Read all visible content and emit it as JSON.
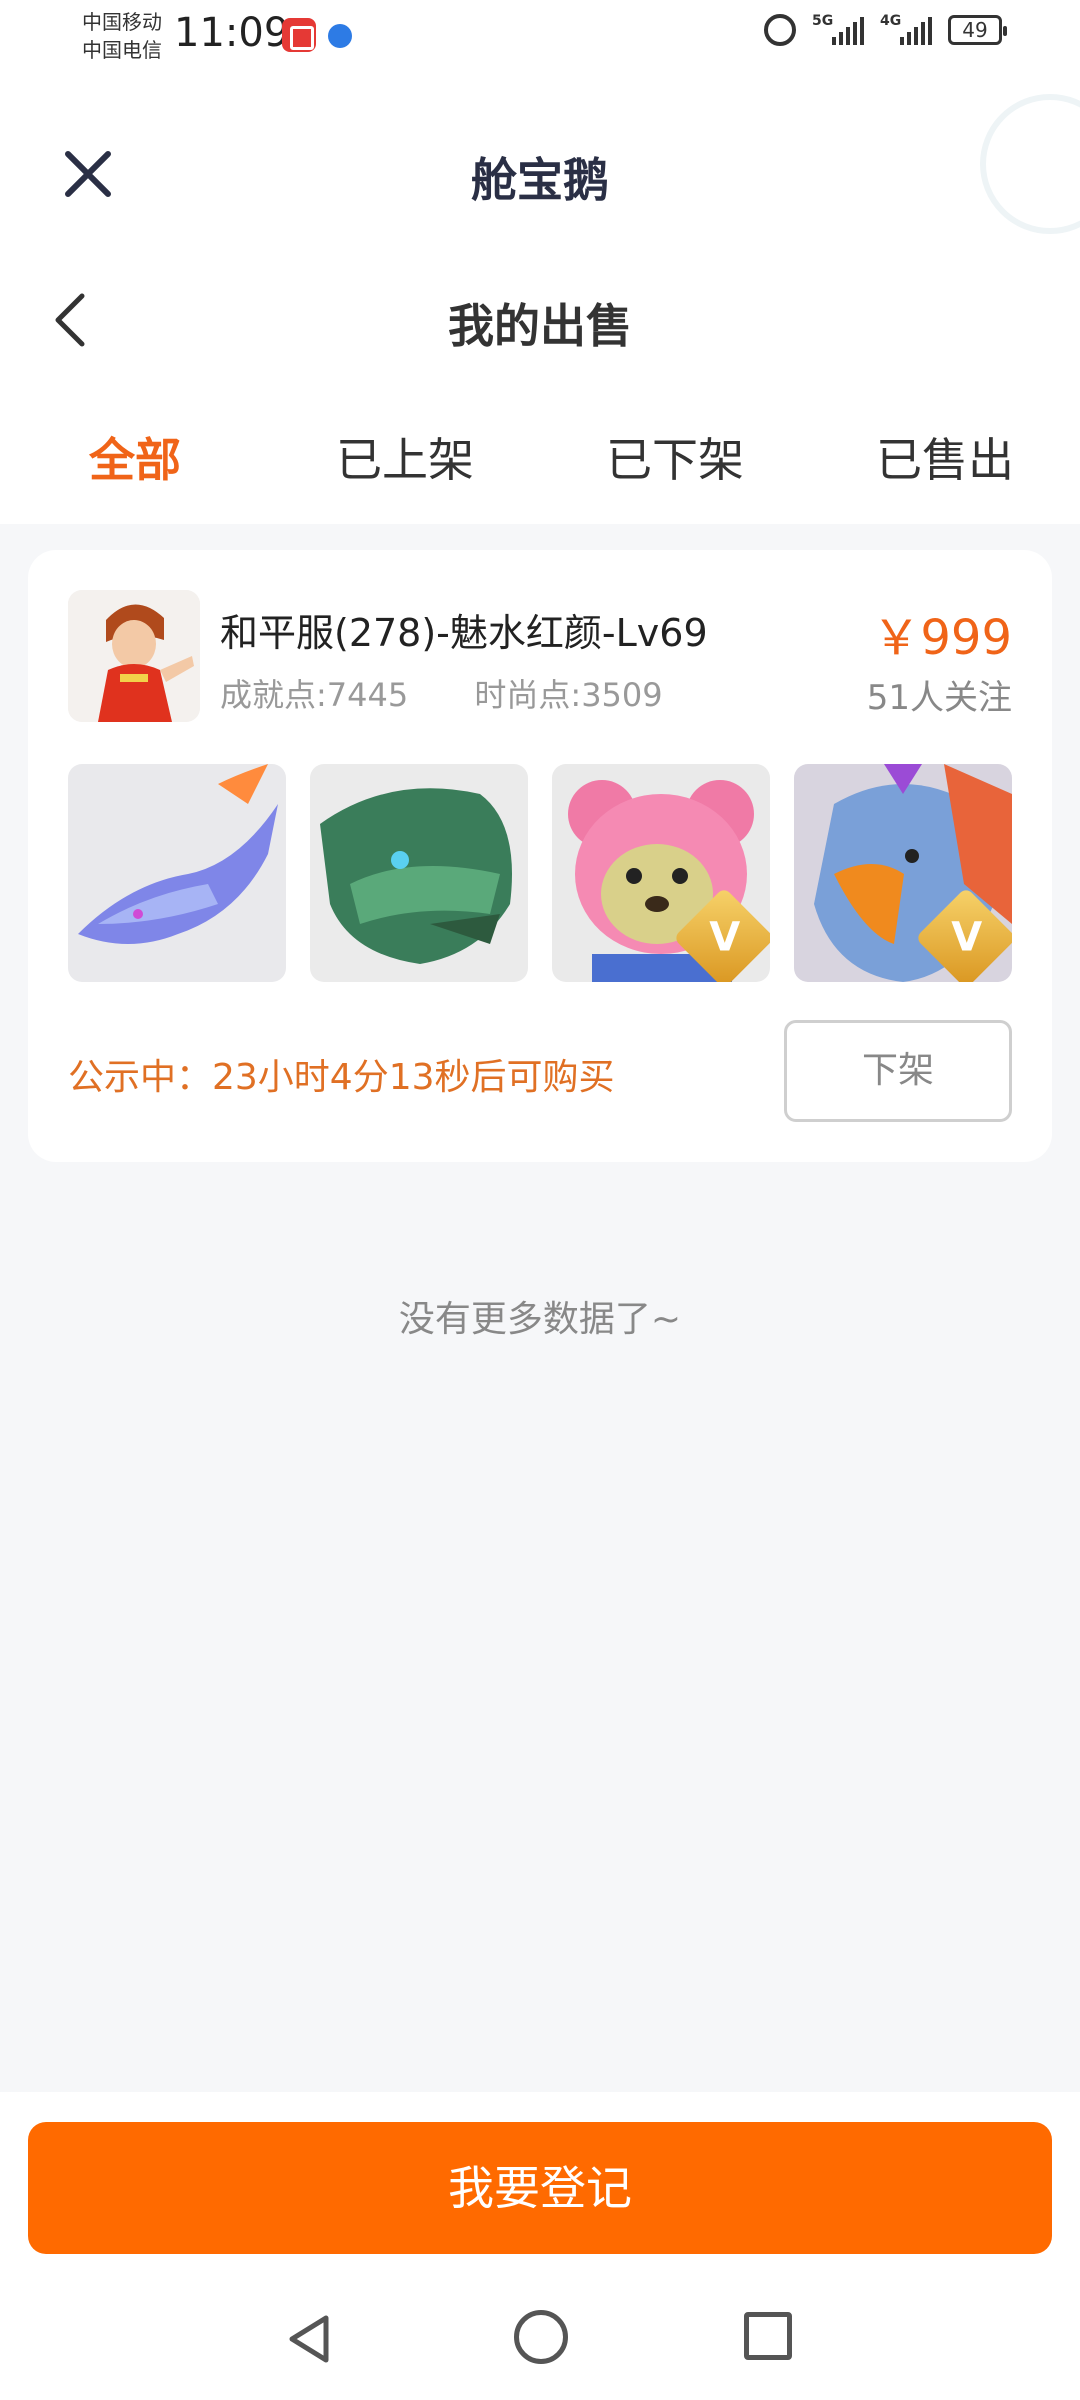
{
  "status_bar": {
    "carrier_1": "中国移动",
    "carrier_2": "中国电信",
    "time": "11:09",
    "signal_1_tag": "5G",
    "signal_2_tag": "4G",
    "battery": "49"
  },
  "titlebar": {
    "app_title": "舱宝鹅"
  },
  "subheader": {
    "title": "我的出售"
  },
  "tabs": [
    {
      "label": "全部",
      "active": true
    },
    {
      "label": "已上架",
      "active": false
    },
    {
      "label": "已下架",
      "active": false
    },
    {
      "label": "已售出",
      "active": false
    }
  ],
  "listing": {
    "title": "和平服(278)-魅水红颜-Lv69",
    "achievement": "成就点:7445",
    "fashion": "时尚点:3509",
    "price": "￥999",
    "followers": "51人关注",
    "thumbnails": [
      {
        "icon": "blue-dragon-mount",
        "badge": ""
      },
      {
        "icon": "green-dragon-mount",
        "badge": ""
      },
      {
        "icon": "pink-bear-pet",
        "badge": "V"
      },
      {
        "icon": "eagle-pet",
        "badge": "V"
      }
    ],
    "notice": "公示中：23小时4分13秒后可购买",
    "delist_label": "下架"
  },
  "list_end_text": "没有更多数据了~",
  "bottom": {
    "primary_label": "我要登记"
  },
  "colors": {
    "accent": "#f06418",
    "primary_button": "#ff6a00"
  }
}
